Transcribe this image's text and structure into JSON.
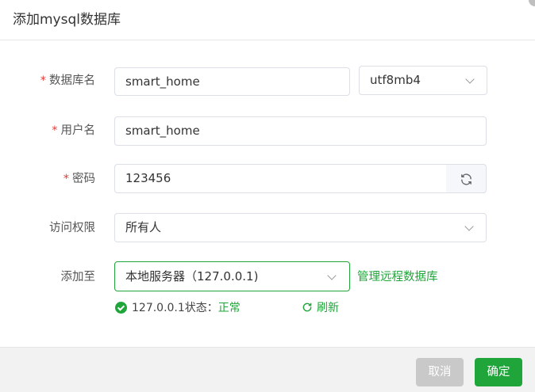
{
  "dialog": {
    "title": "添加mysql数据库"
  },
  "form": {
    "required_mark": "*",
    "db_name": {
      "label": "数据库名",
      "value": "smart_home"
    },
    "charset": {
      "value": "utf8mb4"
    },
    "username": {
      "label": "用户名",
      "value": "smart_home"
    },
    "password": {
      "label": "密码",
      "value": "123456"
    },
    "access": {
      "label": "访问权限",
      "value": "所有人"
    },
    "add_to": {
      "label": "添加至",
      "value": "本地服务器（127.0.0.1)",
      "manage_link": "管理远程数据库"
    },
    "status": {
      "prefix": "127.0.0.1状态：",
      "state": "正常",
      "refresh": "刷新"
    }
  },
  "footer": {
    "cancel": "取消",
    "confirm": "确定"
  },
  "colors": {
    "accent": "#20a53a",
    "required": "#e53935",
    "disabled_button": "#c9c9c9"
  },
  "icons": [
    "refresh-icon",
    "chevron-down-icon",
    "check-circle-icon"
  ]
}
